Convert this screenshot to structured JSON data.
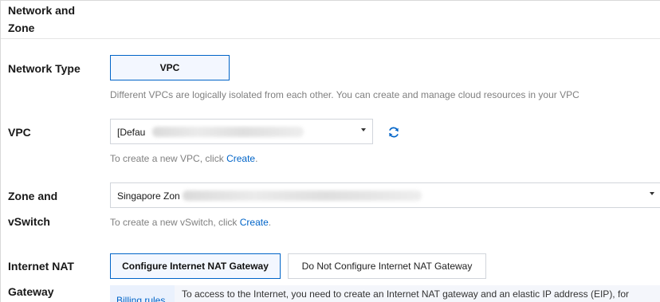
{
  "section": {
    "title": "Network and Zone"
  },
  "network_type": {
    "label": "Network Type",
    "option": "VPC",
    "hint": "Different VPCs are logically isolated from each other. You can create and manage cloud resources in your VPC"
  },
  "vpc": {
    "label": "VPC",
    "value": "[Defau",
    "hint_prefix": "To create a new VPC, click ",
    "hint_link": "Create",
    "hint_suffix": "."
  },
  "zone": {
    "label_line1": "Zone and",
    "label_line2": "vSwitch",
    "value": "Singapore Zon",
    "hint_prefix": "To create a new vSwitch, click ",
    "hint_link": "Create",
    "hint_suffix": "."
  },
  "nat": {
    "label_line1": "Internet NAT",
    "label_line2": "Gateway",
    "option_configure": "Configure Internet NAT Gateway",
    "option_not_configure": "Do Not Configure Internet NAT Gateway",
    "selected": "Configure Internet NAT Gateway",
    "billing_link": "Billing rules",
    "info": "To access to the Internet, you need to create an Internet NAT gateway and an elastic IP address (EIP), for"
  },
  "colors": {
    "accent": "#0064c8",
    "selected_bg": "#f3f7ff"
  }
}
